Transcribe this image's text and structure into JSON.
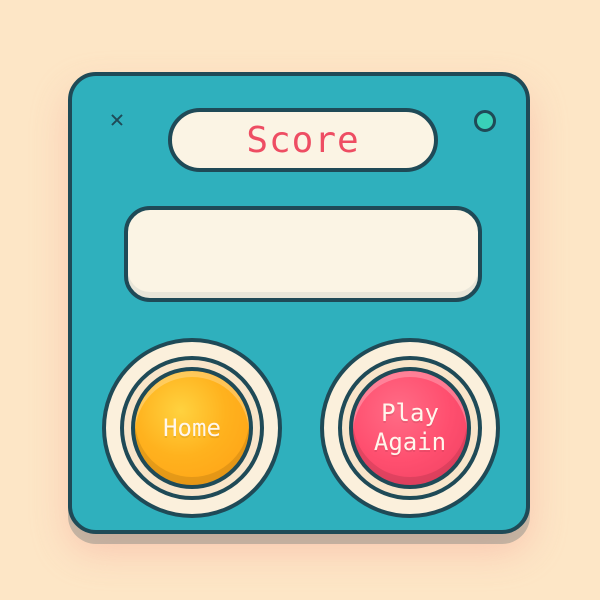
{
  "dialog": {
    "close_icon": "close-icon",
    "status_dot": "green-dot",
    "title": "Score",
    "score_value": "",
    "buttons": {
      "home": "Home",
      "play_again": "Play\nAgain"
    }
  },
  "colors": {
    "background": "#fde6c6",
    "panel": "#2fb0bd",
    "outline": "#1f4a57",
    "title_text": "#ee4d63",
    "home_button": "#ffb21e",
    "play_again_button": "#ff4f6f",
    "status_dot": "#39d1b8"
  }
}
